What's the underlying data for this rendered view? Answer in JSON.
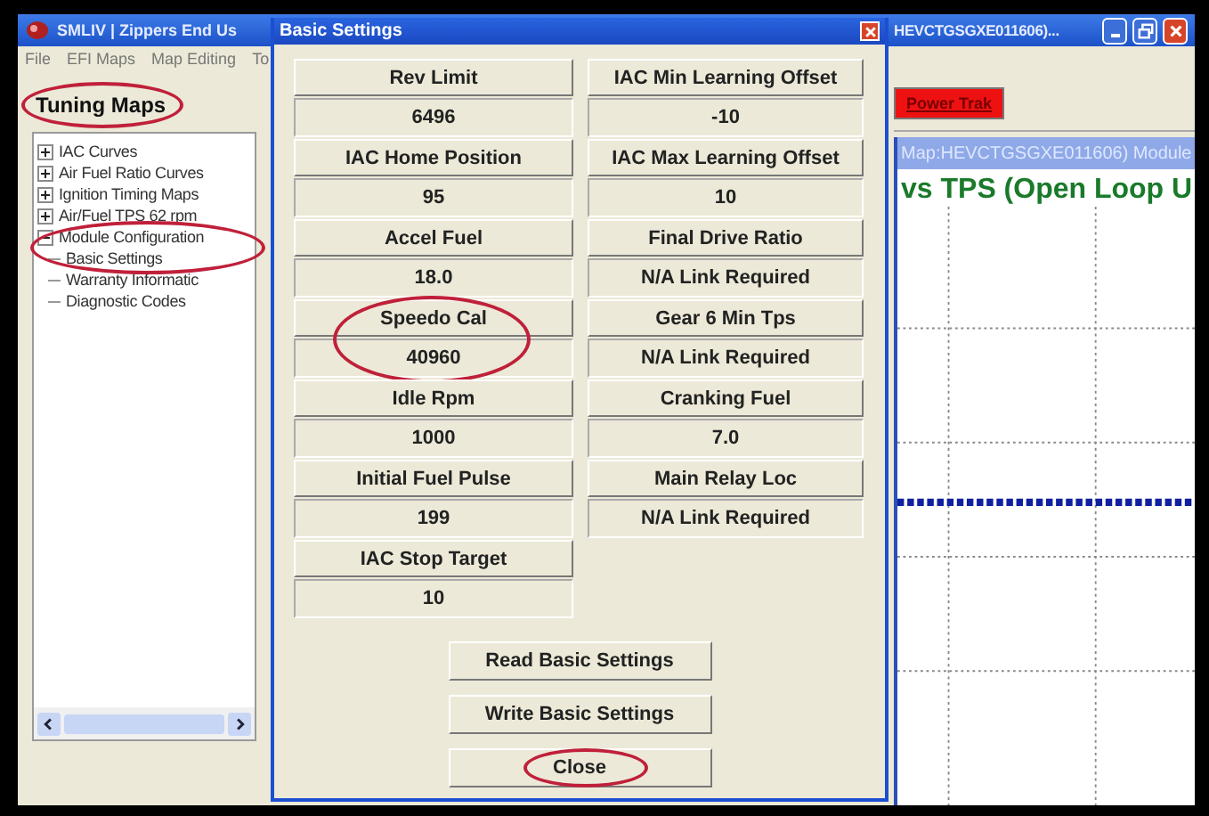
{
  "window": {
    "title": "SMLIV | Zippers End Us",
    "title_right": "HEVCTGSGXE011606)..."
  },
  "menu": [
    "File",
    "EFI Maps",
    "Map Editing",
    "To"
  ],
  "sidebar": {
    "title": "Tuning Maps",
    "title_circled": true,
    "tree": [
      {
        "label": "IAC Curves",
        "expanded": false,
        "circled": false
      },
      {
        "label": "Air Fuel Ratio Curves",
        "expanded": false,
        "circled": false
      },
      {
        "label": "Ignition Timing Maps",
        "expanded": false,
        "circled": false
      },
      {
        "label": "Air/Fuel TPS 62 rpm",
        "expanded": false,
        "circled": false
      },
      {
        "label": "Module Configuration",
        "expanded": true,
        "circled": true,
        "children": [
          {
            "label": "Basic Settings"
          },
          {
            "label": "Warranty Informatic"
          },
          {
            "label": "Diagnostic Codes"
          }
        ]
      }
    ]
  },
  "toolbar": {
    "button": "Power Trak"
  },
  "map_window": {
    "title": "Map:HEVCTGSGXE011606) Module",
    "chart_title": "vs TPS (Open Loop U"
  },
  "dialog": {
    "title": "Basic Settings",
    "columns": [
      [
        {
          "label": "Rev Limit",
          "value": "6496",
          "circled": false
        },
        {
          "label": "IAC Home Position",
          "value": "95",
          "circled": false
        },
        {
          "label": "Accel Fuel",
          "value": "18.0",
          "circled": false
        },
        {
          "label": "Speedo Cal",
          "value": "40960",
          "circled": true
        },
        {
          "label": "Idle Rpm",
          "value": "1000",
          "circled": false
        },
        {
          "label": "Initial Fuel Pulse",
          "value": "199",
          "circled": false
        },
        {
          "label": "IAC Stop Target",
          "value": "10",
          "circled": false
        }
      ],
      [
        {
          "label": "IAC Min Learning Offset",
          "value": "-10",
          "circled": false
        },
        {
          "label": "IAC Max Learning Offset",
          "value": "10",
          "circled": false
        },
        {
          "label": "Final Drive Ratio",
          "value": "N/A Link Required",
          "circled": false
        },
        {
          "label": "Gear 6 Min Tps",
          "value": "N/A Link Required",
          "circled": false
        },
        {
          "label": "Cranking Fuel",
          "value": "7.0",
          "circled": false
        },
        {
          "label": "Main Relay Loc",
          "value": "N/A Link Required",
          "circled": false
        }
      ]
    ],
    "buttons": [
      {
        "label": "Read Basic Settings",
        "circled": false
      },
      {
        "label": "Write Basic Settings",
        "circled": false
      },
      {
        "label": "Close",
        "circled": true
      }
    ]
  }
}
